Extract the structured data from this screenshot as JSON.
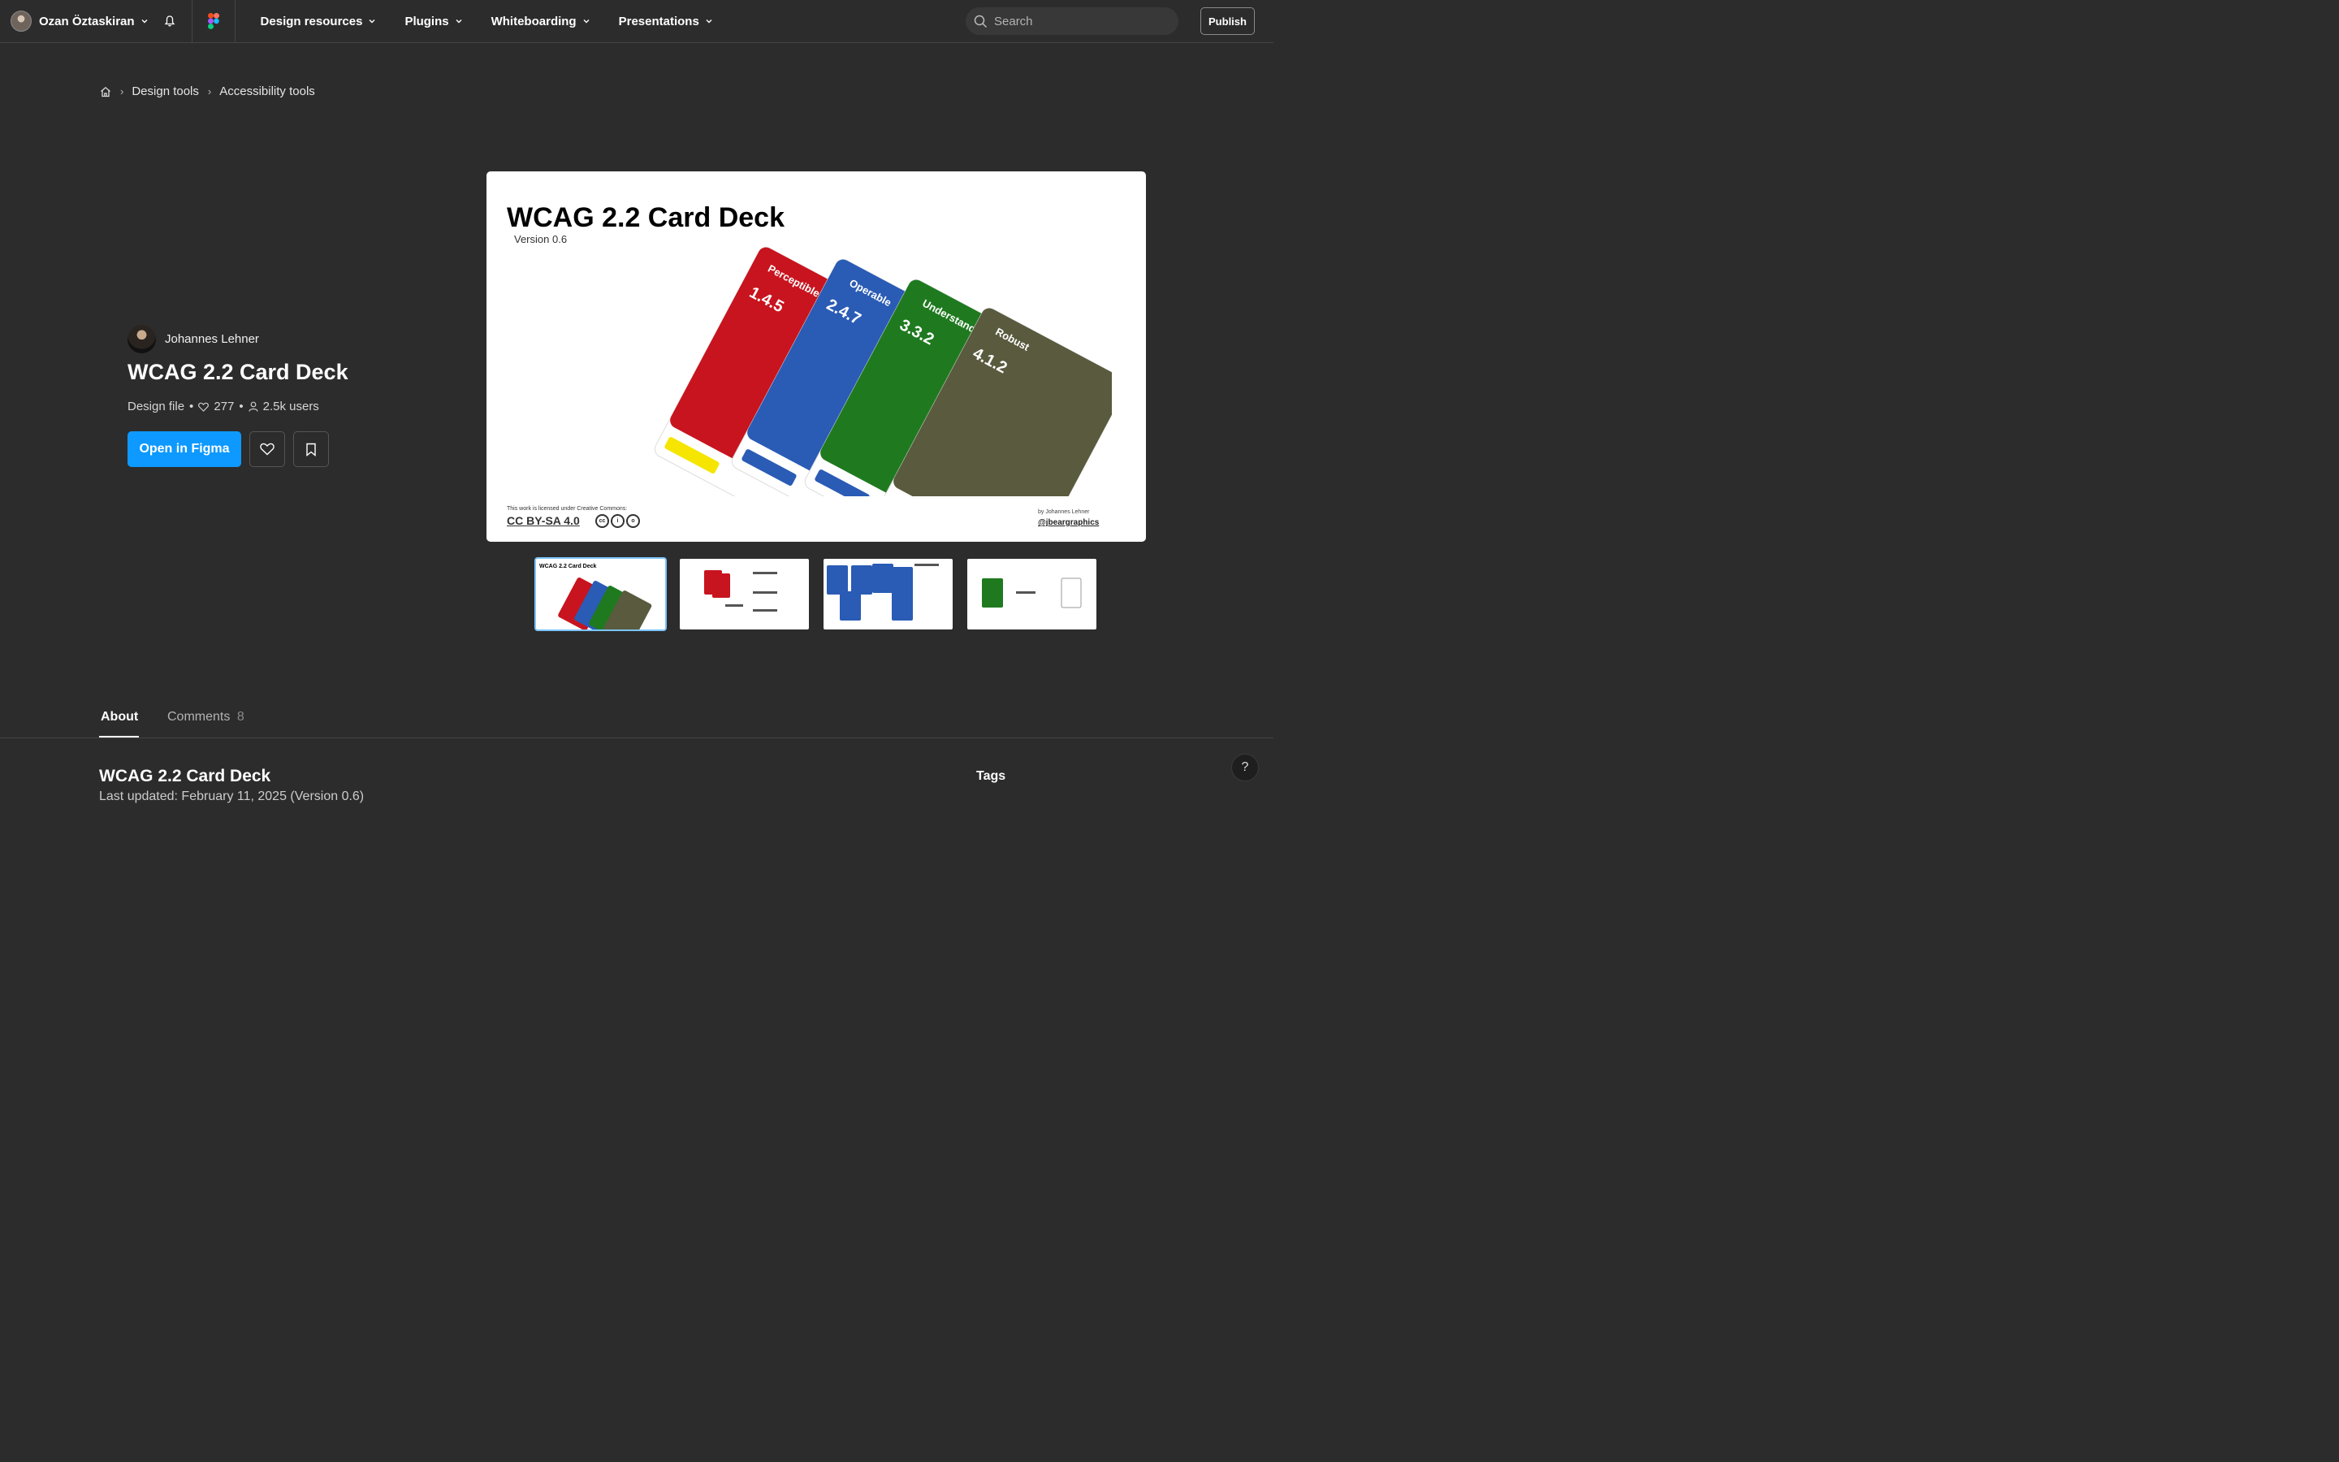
{
  "nav": {
    "user_name": "Ozan Öztaskiran",
    "links": [
      "Design resources",
      "Plugins",
      "Whiteboarding",
      "Presentations"
    ],
    "search_placeholder": "Search",
    "publish_label": "Publish"
  },
  "breadcrumb": {
    "items": [
      "Design tools",
      "Accessibility tools"
    ]
  },
  "file": {
    "author": "Johannes Lehner",
    "title": "WCAG 2.2 Card Deck",
    "type": "Design file",
    "likes": "277",
    "users": "2.5k users",
    "open_label": "Open in Figma"
  },
  "preview": {
    "title": "WCAG 2.2 Card Deck",
    "version": "Version 0.6",
    "license_note": "This work is licensed under Creative Commons:",
    "license": "CC BY-SA 4.0",
    "by": "by Johannes Lehner",
    "handle": "@jbeargraphics",
    "cards": [
      {
        "category": "Perceptible",
        "number": "1.4.5",
        "color": "#c8141e"
      },
      {
        "category": "Operable",
        "number": "2.4.7",
        "color": "#2a5bb5"
      },
      {
        "category": "Understand",
        "number": "3.3.2",
        "color": "#1f7a1f"
      },
      {
        "category": "Robust",
        "number": "4.1.2",
        "color": "#5a5a3e"
      }
    ]
  },
  "thumbnails": [
    {
      "label": "WCAG 2.2 Card Deck",
      "active": true
    },
    {
      "label": "",
      "active": false
    },
    {
      "label": "",
      "active": false
    },
    {
      "label": "",
      "active": false
    }
  ],
  "tabs": {
    "about": "About",
    "comments": "Comments",
    "comments_count": "8"
  },
  "about": {
    "title": "WCAG 2.2 Card Deck",
    "last_updated": "Last updated: February 11, 2025 (Version 0.6)"
  },
  "sidebar": {
    "tags_title": "Tags"
  },
  "help_label": "?",
  "colors": {
    "accent": "#0d99ff",
    "background": "#2c2c2c"
  }
}
